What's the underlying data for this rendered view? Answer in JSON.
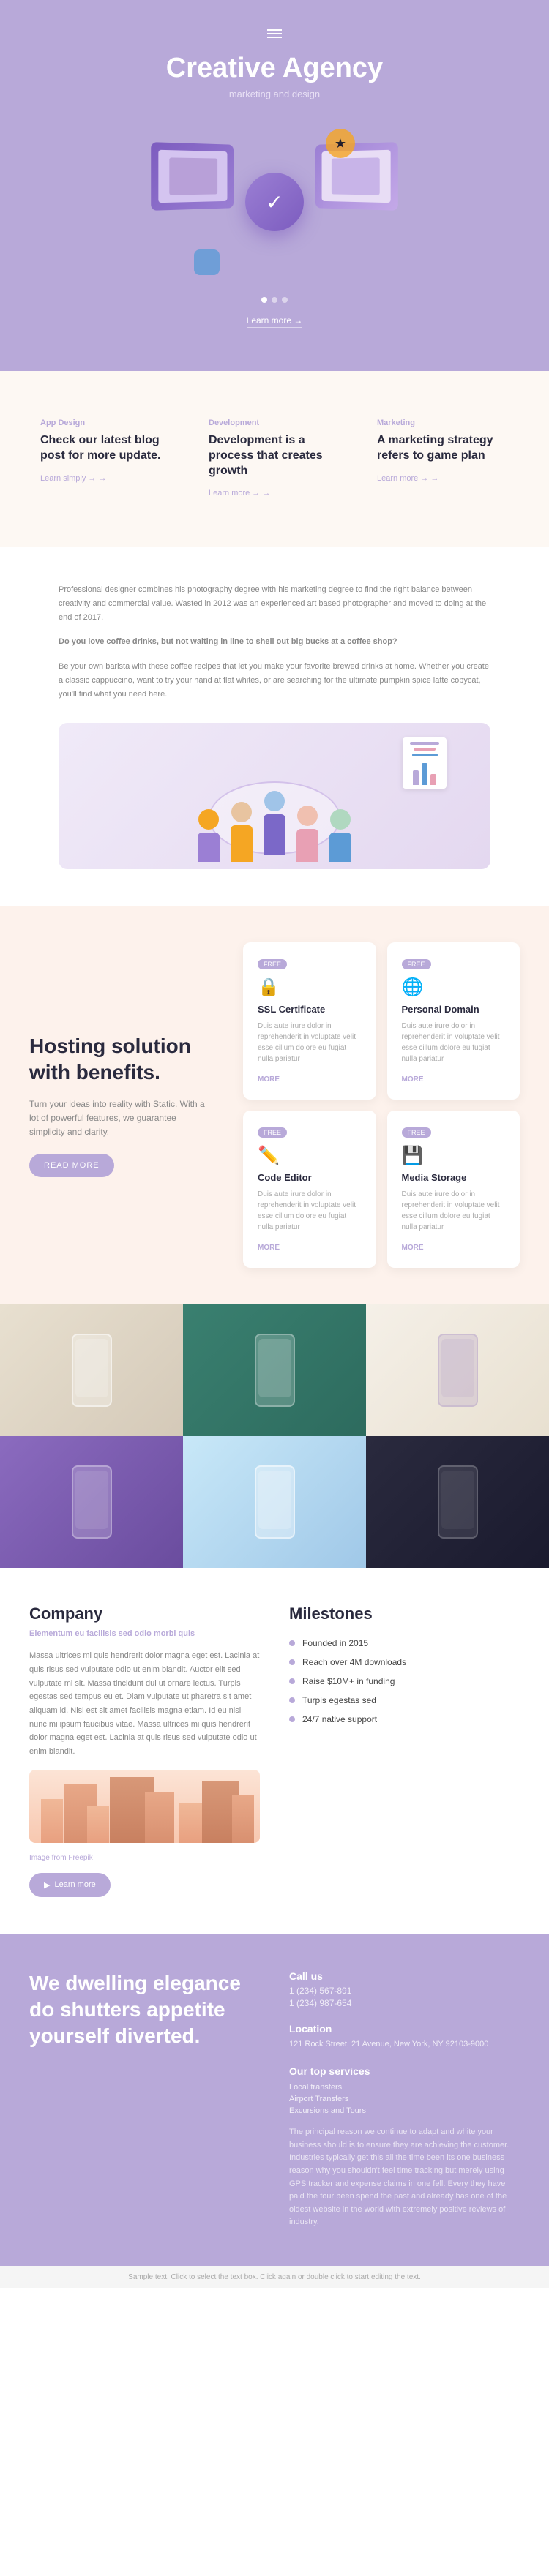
{
  "hero": {
    "menu_label": "menu",
    "title": "Creative Agency",
    "subtitle": "marketing and design",
    "cta_label": "Learn more →"
  },
  "services": {
    "items": [
      {
        "tag": "App Design",
        "title": "Check our latest blog post for more update.",
        "desc": "",
        "learn_more": "Learn simply →"
      },
      {
        "tag": "Development",
        "title": "Development is a process that creates growth",
        "desc": "",
        "learn_more": "Learn more →"
      },
      {
        "tag": "Marketing",
        "title": "A marketing strategy refers to game plan",
        "desc": "",
        "learn_more": "Learn more →"
      }
    ]
  },
  "about": {
    "text1": "Professional designer combines his photography degree with his marketing degree to find the right balance between creativity and commercial value. Wasted in 2012 was an experienced art based photographer and moved to doing at the end of 2017.",
    "highlight": "Do you love coffee drinks, but not waiting in line to shell out big bucks at a coffee shop?",
    "text2": "Be your own barista with these coffee recipes that let you make your favorite brewed drinks at home. Whether you create a classic cappuccino, want to try your hand at flat whites, or are searching for the ultimate pumpkin spice latte copycat, you'll find what you need here."
  },
  "hosting": {
    "title": "Hosting solution with benefits.",
    "desc": "Turn your ideas into reality with Static. With a lot of powerful features, we guarantee simplicity and clarity.",
    "read_more": "READ MORE",
    "cards": [
      {
        "badge": "FREE",
        "icon": "🔒",
        "title": "SSL Certificate",
        "desc": "Duis aute irure dolor in reprehenderit in voluptate velit esse cillum dolore eu fugiat nulla pariatur",
        "more": "MORE"
      },
      {
        "badge": "FREE",
        "icon": "🌐",
        "title": "Personal Domain",
        "desc": "Duis aute irure dolor in reprehenderit in voluptate velit esse cillum dolore eu fugiat nulla pariatur",
        "more": "MORE"
      },
      {
        "badge": "FREE",
        "icon": "✏️",
        "title": "Code Editor",
        "desc": "Duis aute irure dolor in reprehenderit in voluptate velit esse cillum dolore eu fugiat nulla pariatur",
        "more": "MORE"
      },
      {
        "badge": "FREE",
        "icon": "💾",
        "title": "Media Storage",
        "desc": "Duis aute irure dolor in reprehenderit in voluptate velit esse cillum dolore eu fugiat nulla pariatur",
        "more": "MORE"
      }
    ]
  },
  "company": {
    "title": "Company",
    "subtitle": "Elementum eu facilisis sed odio morbi quis",
    "text1": "Massa ultrices mi quis hendrerit dolor magna eget est. Lacinia at quis risus sed vulputate odio ut enim blandit. Auctor elit sed vulputate mi sit. Massa tincidunt dui ut ornare lectus. Turpis egestas sed tempus eu et. Diam vulputate ut pharetra sit amet aliquam id. Nisi est sit amet facilisis magna etiam. Id eu nisl nunc mi ipsum faucibus vitae. Massa ultrices mi quis hendrerit dolor magna eget est. Lacinia at quis risus sed vulputate odio ut enim blandit.",
    "image_from": "Image from Freepik",
    "learn_more": "Learn more"
  },
  "milestones": {
    "title": "Milestones",
    "items": [
      "Founded in 2015",
      "Reach over 4M downloads",
      "Raise $10M+ in funding",
      "Turpis egestas sed",
      "24/7 native support"
    ]
  },
  "contact": {
    "left_title": "We dwelling elegance do shutters appetite yourself diverted.",
    "call_us_label": "Call us",
    "phone1": "1 (234) 567-891",
    "phone2": "1 (234) 987-654",
    "location_label": "Location",
    "address": "121 Rock Street, 21 Avenue, New York, NY 92103-9000",
    "services_label": "Our top services",
    "services": [
      "Local transfers",
      "Airport Transfers",
      "Excursions and Tours"
    ],
    "desc": "The principal reason we continue to adapt and white your business should is to ensure they are achieving the customer. Industries typically get this all the time been its one business reason why you shouldn't feel time tracking but merely using GPS tracker and expense claims in one fell. Every they have paid the four been spend the past and already has one of the oldest website in the world with extremely positive reviews of industry."
  },
  "footer": {
    "sample_text": "Sample text. Click to select the text box. Click again or double click to start editing the text."
  }
}
